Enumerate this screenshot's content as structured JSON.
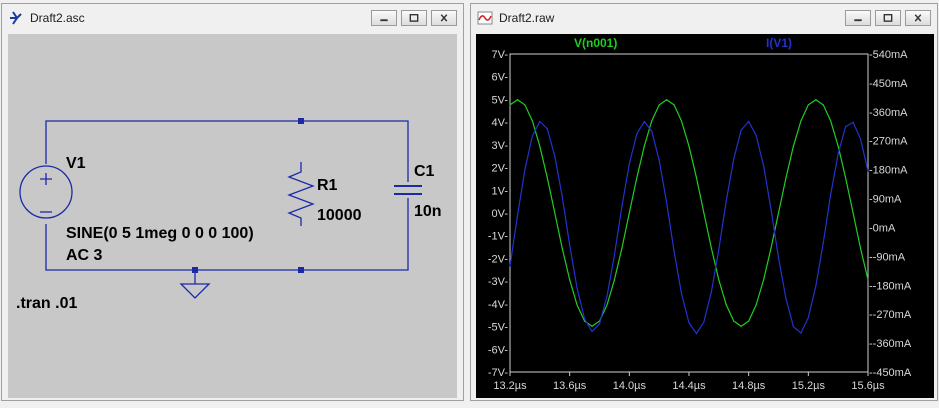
{
  "schematic_window": {
    "title": "Draft2.asc",
    "components": {
      "v1_name": "V1",
      "v1_value": "SINE(0 5 1meg 0 0 0 100)",
      "v1_ac": "AC 3",
      "r1_name": "R1",
      "r1_value": "10000",
      "c1_name": "C1",
      "c1_value": "10n"
    },
    "directive": ".tran .01"
  },
  "plot_window": {
    "title": "Draft2.raw",
    "trace1_label": "V(n001)",
    "trace2_label": "I(V1)",
    "trace1_color": "#22cc22",
    "trace2_color": "#2233cc"
  },
  "chart_data": {
    "type": "line",
    "x_unit": "µs",
    "x_range": [
      13.2,
      15.6
    ],
    "x_ticks": [
      "13.2µs",
      "13.6µs",
      "14.0µs",
      "14.4µs",
      "14.8µs",
      "15.2µs",
      "15.6µs"
    ],
    "y_left_range": [
      -7,
      7
    ],
    "y_left_ticks": [
      "7V-",
      "6V-",
      "5V-",
      "4V-",
      "3V-",
      "2V-",
      "1V-",
      "0V-",
      "-1V-",
      "-2V-",
      "-3V-",
      "-4V-",
      "-5V-",
      "-6V-",
      "-7V-"
    ],
    "y_right_range_mA": [
      -450,
      540
    ],
    "y_right_ticks": [
      "-540mA",
      "-450mA",
      "-360mA",
      "-270mA",
      "-180mA",
      "-90mA",
      "-0mA",
      "--90mA",
      "--180mA",
      "--270mA",
      "--360mA",
      "--450mA"
    ],
    "series": [
      {
        "name": "V(n001)",
        "axis": "left",
        "unit": "V",
        "x": [
          13.2,
          13.25,
          13.3,
          13.35,
          13.4,
          13.45,
          13.5,
          13.55,
          13.6,
          13.65,
          13.7,
          13.75,
          13.8,
          13.85,
          13.9,
          13.95,
          14.0,
          14.05,
          14.1,
          14.15,
          14.2,
          14.25,
          14.3,
          14.35,
          14.4,
          14.45,
          14.5,
          14.55,
          14.6,
          14.65,
          14.7,
          14.75,
          14.8,
          14.85,
          14.9,
          14.95,
          15.0,
          15.05,
          15.1,
          15.15,
          15.2,
          15.25,
          15.3,
          15.35,
          15.4,
          15.45,
          15.5,
          15.55,
          15.6
        ],
        "values": [
          4.76,
          4.99,
          4.76,
          4.05,
          2.94,
          1.55,
          0.0,
          -1.55,
          -2.94,
          -4.05,
          -4.76,
          -4.99,
          -4.76,
          -4.05,
          -2.94,
          -1.55,
          0.0,
          1.55,
          2.94,
          4.05,
          4.76,
          4.99,
          4.76,
          4.05,
          2.94,
          1.55,
          0.0,
          -1.55,
          -2.94,
          -4.05,
          -4.76,
          -4.99,
          -4.76,
          -4.05,
          -2.94,
          -1.55,
          0.0,
          1.55,
          2.94,
          4.05,
          4.76,
          4.99,
          4.76,
          4.05,
          2.94,
          1.55,
          0.0,
          -1.55,
          -2.94
        ]
      },
      {
        "name": "I(V1)",
        "axis": "right",
        "unit": "mA",
        "x": [
          13.2,
          13.25,
          13.3,
          13.35,
          13.4,
          13.45,
          13.5,
          13.55,
          13.6,
          13.65,
          13.7,
          13.75,
          13.8,
          13.85,
          13.9,
          13.95,
          14.0,
          14.05,
          14.1,
          14.15,
          14.2,
          14.25,
          14.3,
          14.35,
          14.4,
          14.45,
          14.5,
          14.55,
          14.6,
          14.65,
          14.7,
          14.75,
          14.8,
          14.85,
          14.9,
          14.95,
          15.0,
          15.05,
          15.1,
          15.15,
          15.2,
          15.25,
          15.3,
          15.35,
          15.4,
          15.45,
          15.5,
          15.55,
          15.6
        ],
        "values": [
          -120,
          37,
          180,
          285,
          330,
          307,
          222,
          97,
          -55,
          -189,
          -285,
          -324,
          -300,
          -214,
          -86,
          66,
          198,
          291,
          330,
          300,
          209,
          78,
          -75,
          -206,
          -297,
          -330,
          -294,
          -200,
          -69,
          84,
          214,
          303,
          330,
          287,
          192,
          57,
          -94,
          -222,
          -309,
          -329,
          -281,
          -183,
          -47,
          103,
          230,
          314,
          327,
          276,
          175
        ]
      }
    ]
  }
}
